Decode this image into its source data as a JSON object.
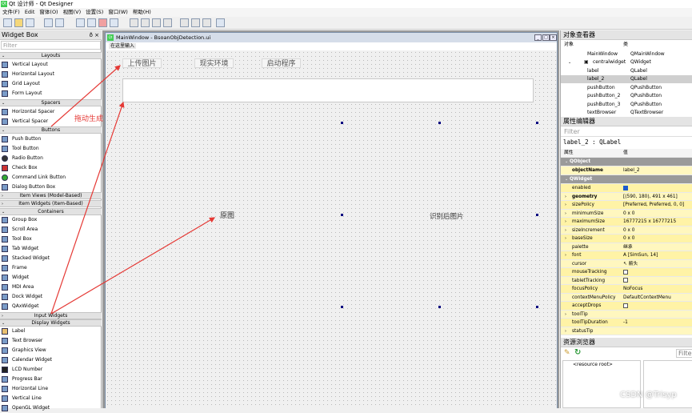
{
  "app": {
    "title": "Qt 设计师 - Qt Designer",
    "icon_text": "Qt"
  },
  "menu": [
    "文件(F)",
    "Edit",
    "窗体(O)",
    "视图(V)",
    "设置(S)",
    "窗口(W)",
    "帮助(H)"
  ],
  "widget_box": {
    "title": "Widget Box",
    "dock_buttons": "ð ×",
    "filter_placeholder": "Filter",
    "cat_layouts": "Layouts",
    "layouts": [
      "Vertical Layout",
      "Horizontal Layout",
      "Grid Layout",
      "Form Layout"
    ],
    "cat_spacers": "Spacers",
    "spacers": [
      "Horizontal Spacer",
      "Vertical Spacer"
    ],
    "cat_buttons": "Buttons",
    "buttons": [
      "Push Button",
      "Tool Button",
      "Radio Button",
      "Check Box",
      "Command Link Button",
      "Dialog Button Box"
    ],
    "cat_item_views": "Item Views (Model-Based)",
    "cat_item_widgets": "Item Widgets (Item-Based)",
    "cat_containers": "Containers",
    "containers": [
      "Group Box",
      "Scroll Area",
      "Tool Box",
      "Tab Widget",
      "Stacked Widget",
      "Frame",
      "Widget",
      "MDI Area",
      "Dock Widget",
      "QAxWidget"
    ],
    "cat_input": "Input Widgets",
    "cat_display": "Display Widgets",
    "display": [
      "Label",
      "Text Browser",
      "Graphics View",
      "Calendar Widget",
      "LCD Number",
      "Progress Bar",
      "Horizontal Line",
      "Vertical Line",
      "OpenGL Widget"
    ]
  },
  "form": {
    "window_title": "MainWindow - BsoanObjDetection.ui",
    "icon_text": "Qt",
    "menubar_placeholder": "在这里输入",
    "btn_upload": "上传图片",
    "btn_env": "现实环境",
    "btn_start": "启动程序",
    "label_original": "原图",
    "label_result": "识别后图片",
    "win_buttons": [
      "_",
      "□",
      "×"
    ]
  },
  "annotation": {
    "text": "拖动生成",
    "color": "#e53935"
  },
  "object_inspector": {
    "title": "对象查看器",
    "col_object": "对象",
    "col_class": "类",
    "rows": [
      {
        "name": "MainWindow",
        "cls": "QMainWindow"
      },
      {
        "name": "centralwidget",
        "cls": "QWidget"
      },
      {
        "name": "label",
        "cls": "QLabel"
      },
      {
        "name": "label_2",
        "cls": "QLabel"
      },
      {
        "name": "pushButton",
        "cls": "QPushButton"
      },
      {
        "name": "pushButton_2",
        "cls": "QPushButton"
      },
      {
        "name": "pushButton_3",
        "cls": "QPushButton"
      },
      {
        "name": "textBrowser",
        "cls": "QTextBrowser"
      }
    ]
  },
  "property_editor": {
    "title": "属性编辑器",
    "filter_placeholder": "Filter",
    "object_line": "label_2 : QLabel",
    "col_property": "属性",
    "col_value": "值",
    "sec_qobject": "QObject",
    "object_name": {
      "name": "objectName",
      "value": "label_2"
    },
    "sec_qwidget": "QWidget",
    "props": [
      {
        "name": "enabled",
        "value": "",
        "check": "on"
      },
      {
        "name": "geometry",
        "value": "[(590, 180), 491 x 461]"
      },
      {
        "name": "sizePolicy",
        "value": "[Preferred, Preferred, 0, 0]"
      },
      {
        "name": "minimumSize",
        "value": "0 x 0"
      },
      {
        "name": "maximumSize",
        "value": "16777215 x 16777215"
      },
      {
        "name": "sizeIncrement",
        "value": "0 x 0"
      },
      {
        "name": "baseSize",
        "value": "0 x 0"
      },
      {
        "name": "palette",
        "value": "继承"
      },
      {
        "name": "font",
        "value": "A  [SimSun, 14]"
      },
      {
        "name": "cursor",
        "value": "↖ 箭头"
      },
      {
        "name": "mouseTracking",
        "value": "",
        "check": "off"
      },
      {
        "name": "tabletTracking",
        "value": "",
        "check": "off"
      },
      {
        "name": "focusPolicy",
        "value": "NoFocus"
      },
      {
        "name": "contextMenuPolicy",
        "value": "DefaultContextMenu"
      },
      {
        "name": "acceptDrops",
        "value": "",
        "check": "off"
      },
      {
        "name": "toolTip",
        "value": ""
      },
      {
        "name": "toolTipDuration",
        "value": "-1"
      },
      {
        "name": "statusTip",
        "value": ""
      }
    ]
  },
  "resource_browser": {
    "title": "资源浏览器",
    "filter_placeholder": "Filter",
    "root": "<resource root>"
  },
  "watermark": "CSDN @Trisyp"
}
